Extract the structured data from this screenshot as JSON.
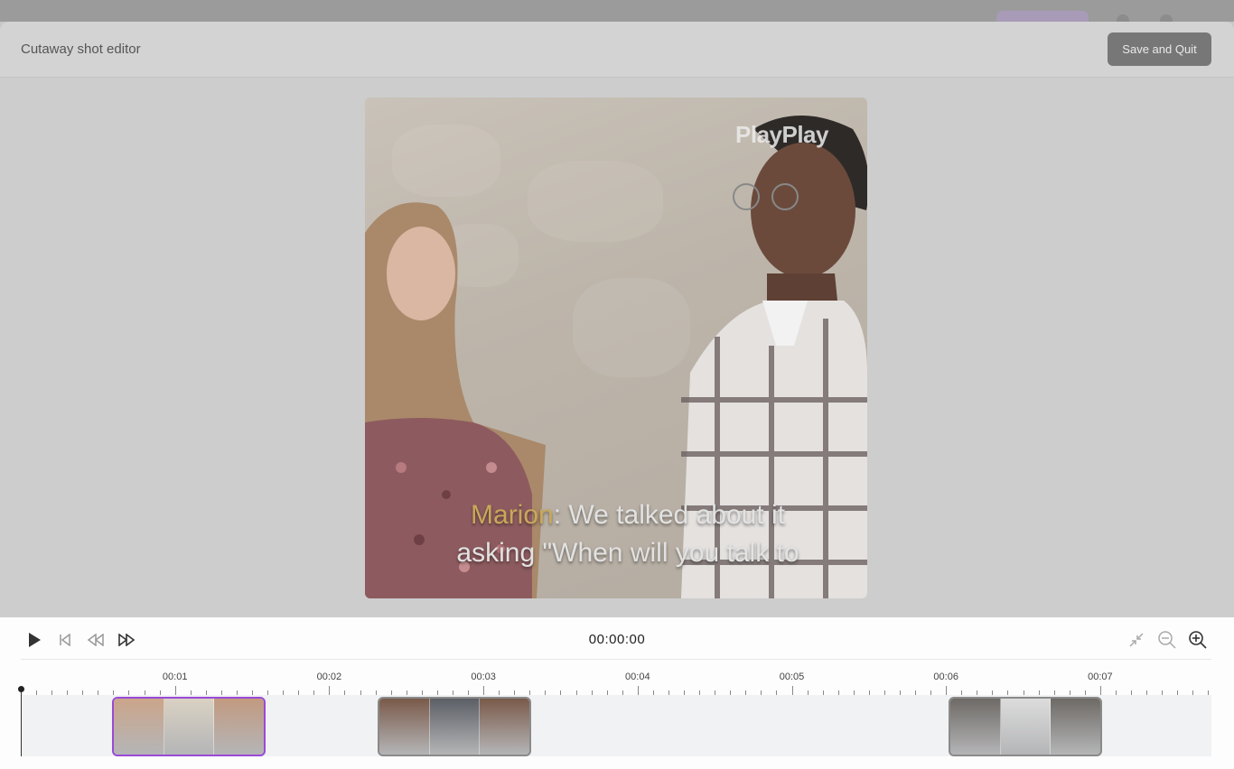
{
  "modal": {
    "title": "Cutaway shot editor",
    "save_quit_label": "Save and Quit"
  },
  "preview": {
    "watermark": "PlayPlay",
    "caption_speaker": "Marion",
    "caption_line1": ": We talked about it",
    "caption_line2": "asking \"When will you talk to"
  },
  "player": {
    "timecode": "00:00:00",
    "controls": [
      "play-icon",
      "skip-to-start-icon",
      "rewind-icon",
      "fast-forward-icon"
    ],
    "zoom_controls": [
      "collapse-icon",
      "zoom-out-icon",
      "zoom-in-icon"
    ]
  },
  "timeline": {
    "ticks": [
      "00:01",
      "00:02",
      "00:03",
      "00:04",
      "00:05",
      "00:06",
      "00:07"
    ],
    "clips": [
      {
        "name": "clip-meeting-room",
        "selected": true,
        "colors": [
          "#caa58a",
          "#d9d1c3",
          "#c29a80"
        ]
      },
      {
        "name": "clip-city-sunset",
        "selected": false,
        "colors": [
          "#7a5a4a",
          "#5c5f66",
          "#7a5a4a"
        ]
      },
      {
        "name": "clip-presentation",
        "selected": false,
        "colors": [
          "#6e6a66",
          "#dcdcdc",
          "#6e6a66"
        ]
      }
    ]
  },
  "colors": {
    "accent_selected": "#9a4ad6",
    "caption_speaker": "#c9a85a"
  }
}
